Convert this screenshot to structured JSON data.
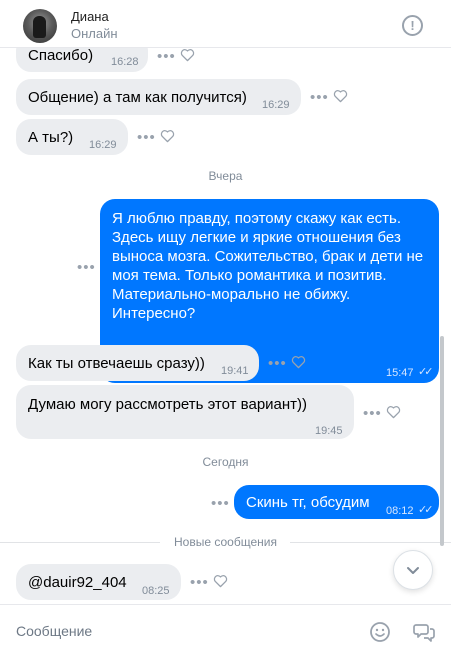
{
  "header": {
    "name": "Диана",
    "status": "Онлайн",
    "info_icon": "info-icon"
  },
  "messages": [
    {
      "dir": "in",
      "text": "Спасибо)",
      "time": "16:28"
    },
    {
      "dir": "in",
      "text": "Общение) а там как получится)",
      "time": "16:29"
    },
    {
      "dir": "in",
      "text": "А ты?)",
      "time": "16:29"
    },
    {
      "dir": "out",
      "lines": [
        "Я люблю правду, поэтому скажу как есть.",
        "Здесь ищу легкие и яркие отношения без",
        "выноса мозга. Сожительство, брак и дети не",
        "моя тема. Только романтика и позитив.",
        "Материально-морально не обижу.",
        "Интересно?"
      ],
      "time": "15:47"
    },
    {
      "dir": "in",
      "text": "Как ты отвечаешь сразу))",
      "time": "19:41"
    },
    {
      "dir": "in",
      "text": "Думаю могу рассмотреть этот вариант))",
      "time": "19:45"
    },
    {
      "dir": "out",
      "text": "Скинь тг, обсудим",
      "time": "08:12"
    },
    {
      "dir": "in",
      "text": "@dauir92_404",
      "time": "08:25"
    }
  ],
  "days": {
    "yesterday": "Вчера",
    "today": "Сегодня"
  },
  "new_messages_label": "Новые сообщения",
  "composer": {
    "placeholder": "Сообщение",
    "emoji_icon": "smile-icon",
    "voice_icon": "voice-message-icon"
  },
  "colors": {
    "incoming_bubble": "#ebedf0",
    "outgoing_bubble": "#0077ff",
    "meta_text": "#818c99"
  }
}
